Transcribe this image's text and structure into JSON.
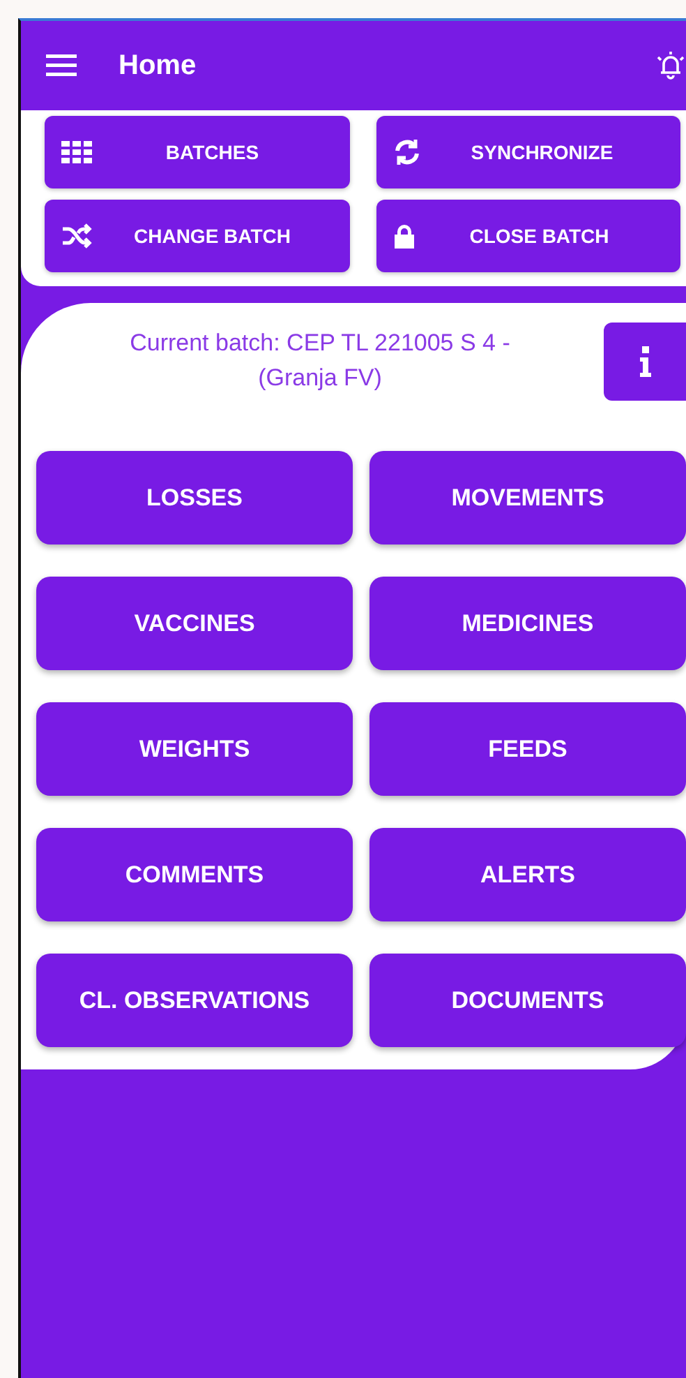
{
  "app_bar": {
    "title": "Home"
  },
  "actions": [
    "BATCHES",
    "SYNCHRONIZE",
    "CHANGE BATCH",
    "CLOSE BATCH"
  ],
  "current_batch": {
    "text": "Current batch: CEP TL 221005 S 4 - (Granja FV)"
  },
  "menu": [
    "LOSSES",
    "MOVEMENTS",
    "VACCINES",
    "MEDICINES",
    "WEIGHTS",
    "FEEDS",
    "COMMENTS",
    "ALERTS",
    "CL. OBSERVATIONS",
    "DOCUMENTS"
  ]
}
